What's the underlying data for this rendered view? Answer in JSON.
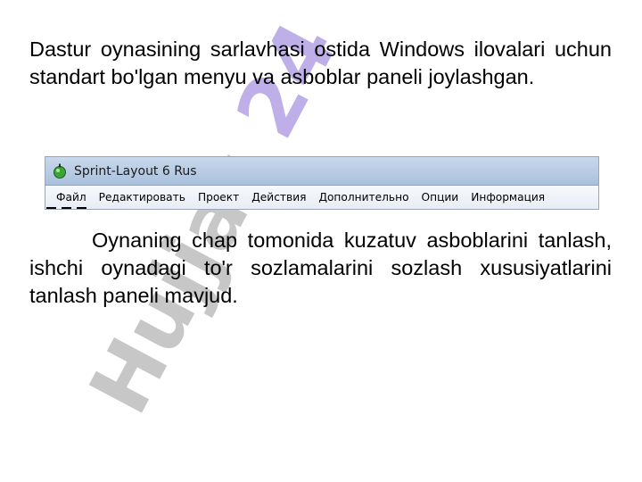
{
  "paragraph_1": "Dastur oynasining sarlavhasi ostida Windows ilovalari uchun standart bo'lgan menyu va asboblar paneli joylashgan.",
  "window": {
    "title": "Sprint-Layout 6 Rus",
    "menu": [
      "Файл",
      "Редактировать",
      "Проект",
      "Действия",
      "Дополнительно",
      "Опции",
      "Информация"
    ]
  },
  "paragraph_2": "Oynaning chap tomonida kuzatuv asboblarini tanlash, ishchi oynadagi to'r sozlamalarini sozlash xususiyatlarini tanlash paneli mavjud.",
  "watermark": {
    "text_gray": "Hujjat",
    "text_purple": "24",
    "color_gray": "#9a9a9a",
    "color_purple": "#8a6fd8"
  }
}
